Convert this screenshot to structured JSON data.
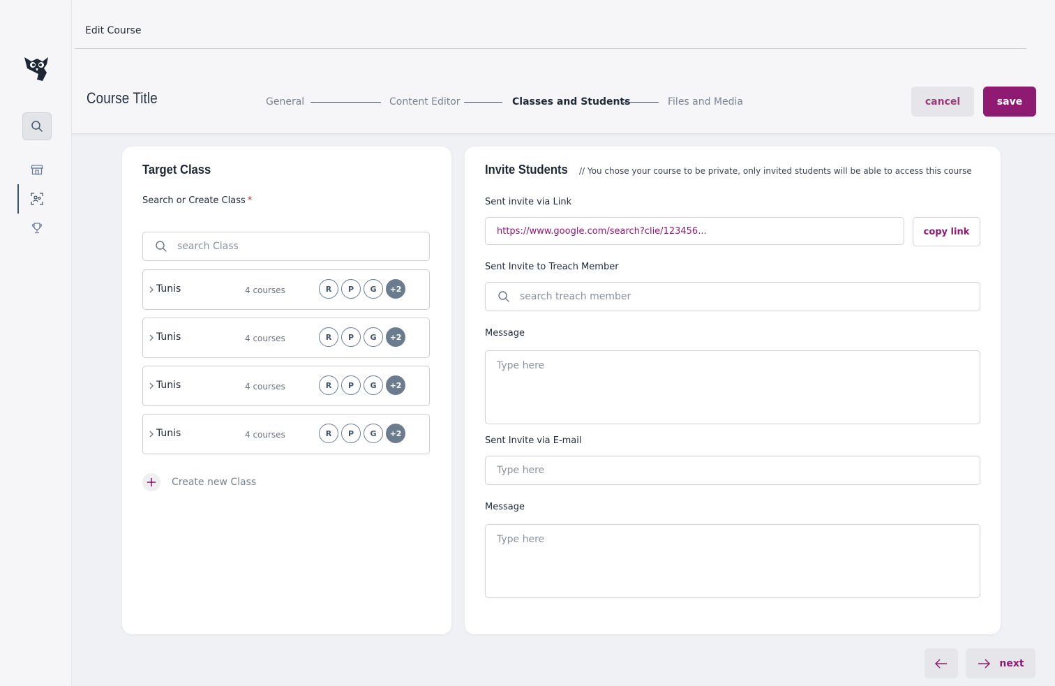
{
  "header": {
    "breadcrumb": "Edit Course",
    "course_title": "Course Title",
    "steps": [
      {
        "label": "General",
        "active": false
      },
      {
        "label": "Content Editor",
        "active": false
      },
      {
        "label": "Classes and Students",
        "active": true
      },
      {
        "label": "Files and Media",
        "active": false
      }
    ],
    "cancel_label": "cancel",
    "save_label": "save"
  },
  "sidebar": {
    "items": [
      {
        "icon": "search-icon"
      },
      {
        "icon": "store-icon"
      },
      {
        "icon": "users-icon",
        "active": true
      },
      {
        "icon": "trophy-icon"
      }
    ]
  },
  "target_class": {
    "title": "Target Class",
    "field_label": "Search or Create Class",
    "required_mark": "*",
    "search_placeholder": "search Class",
    "rows": [
      {
        "name": "Tunis",
        "count": "4 courses",
        "badges": [
          "R",
          "P",
          "G"
        ],
        "more": "+2"
      },
      {
        "name": "Tunis",
        "count": "4 courses",
        "badges": [
          "R",
          "P",
          "G"
        ],
        "more": "+2"
      },
      {
        "name": "Tunis",
        "count": "4 courses",
        "badges": [
          "R",
          "P",
          "G"
        ],
        "more": "+2"
      },
      {
        "name": "Tunis",
        "count": "4 courses",
        "badges": [
          "R",
          "P",
          "G"
        ],
        "more": "+2"
      }
    ],
    "create_label": "Create new Class"
  },
  "invite": {
    "title": "Invite Students",
    "note": "// You chose your course to be private, only invited students will be able to access this course",
    "link_label": "Sent invite via Link",
    "link_value": "https://www.google.com/search?clie/123456...",
    "copy_label": "copy link",
    "member_label": "Sent Invite to Treach Member",
    "member_placeholder": "search treach member",
    "message_label_1": "Message",
    "message_placeholder_1": "Type here",
    "email_label": "Sent Invite via E-mail",
    "email_placeholder": "Type here",
    "message_label_2": "Message",
    "message_placeholder_2": "Type here"
  },
  "footer": {
    "next_label": "next"
  },
  "colors": {
    "accent": "#8e1a72",
    "slate": "#42546a",
    "badge_fill": "#6b7c8f"
  }
}
